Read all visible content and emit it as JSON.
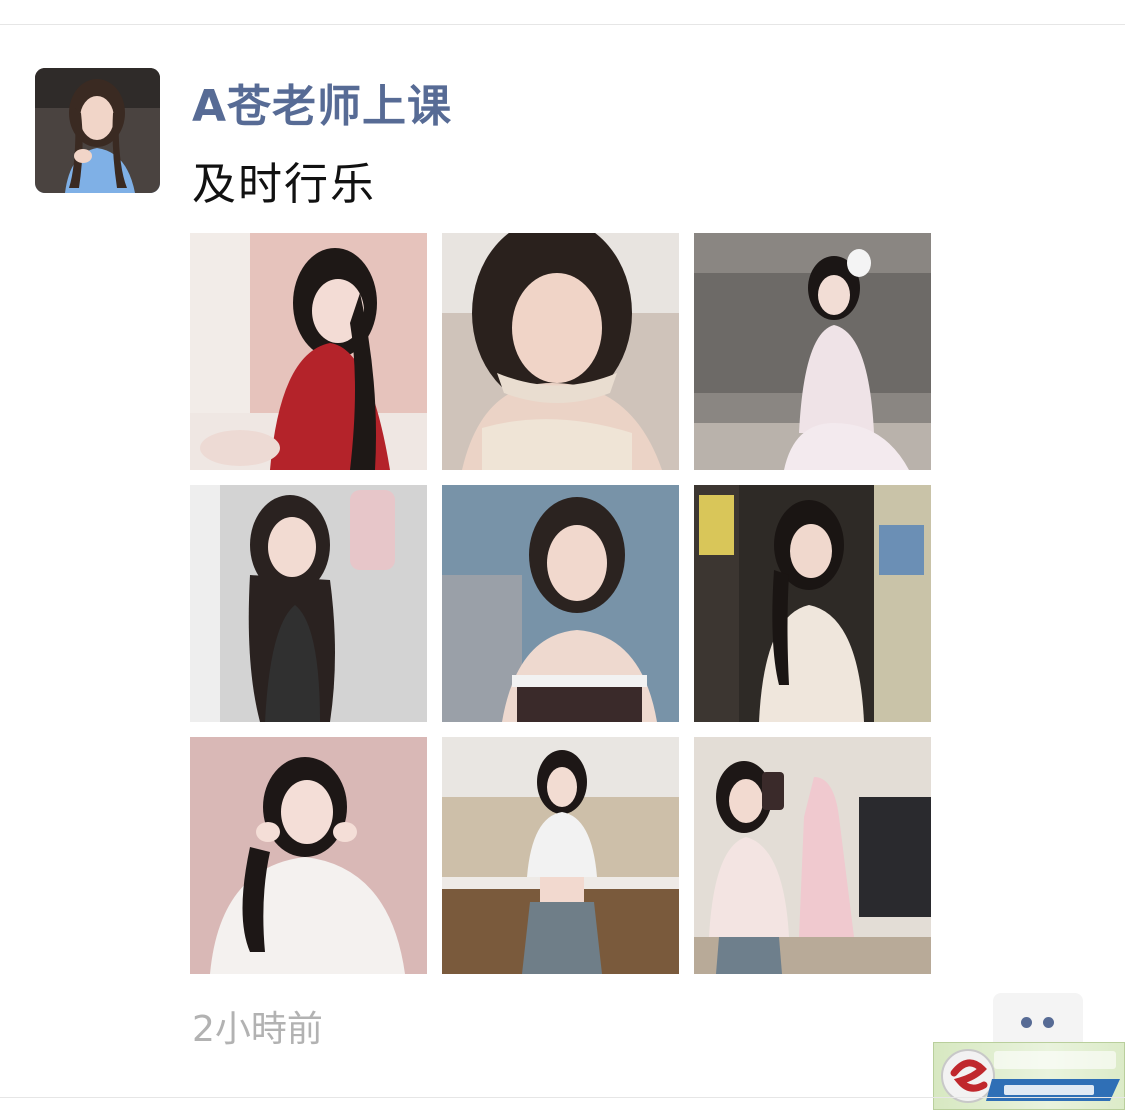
{
  "post": {
    "author_name": "A苍老师上课",
    "text": "及时行乐",
    "time": "2小時前"
  },
  "photos": [
    {
      "tone": "#e8c7c0",
      "accent": "#b4232a"
    },
    {
      "tone": "#cdbfb5",
      "accent": "#efe4d6"
    },
    {
      "tone": "#8f8a86",
      "accent": "#f1e6ea"
    },
    {
      "tone": "#cfcfcf",
      "accent": "#2b2b2b"
    },
    {
      "tone": "#6f8aa0",
      "accent": "#e9d8cf"
    },
    {
      "tone": "#2e2a26",
      "accent": "#efe6dc"
    },
    {
      "tone": "#d9b8b6",
      "accent": "#f4f1ef"
    },
    {
      "tone": "#c9bba6",
      "accent": "#f2f2f2"
    },
    {
      "tone": "#e3ddd6",
      "accent": "#f0c9cf"
    }
  ],
  "colors": {
    "link_blue": "#576b95",
    "time_gray": "#b2b2b2"
  },
  "icons": {
    "more": "two-dots-icon"
  }
}
